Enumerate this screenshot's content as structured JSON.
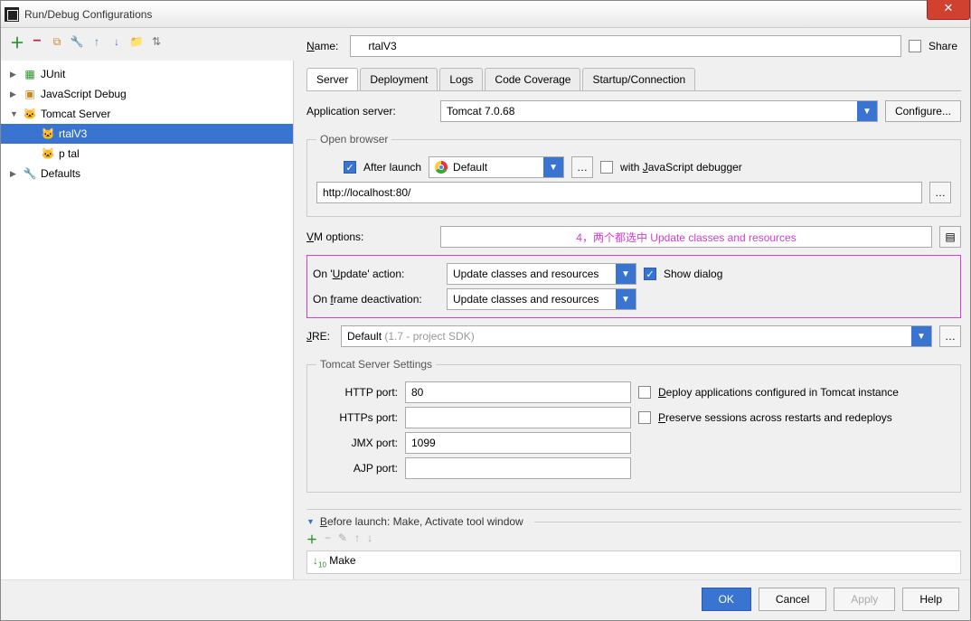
{
  "title": "Run/Debug Configurations",
  "share_label": "Share",
  "toolbar_icons": [
    "add",
    "remove",
    "copy",
    "wrench",
    "up",
    "down",
    "folder",
    "sort"
  ],
  "tree": {
    "items": [
      {
        "label": "JUnit",
        "expandable": true,
        "expanded": false
      },
      {
        "label": "JavaScript Debug",
        "expandable": true,
        "expanded": false
      },
      {
        "label": "Tomcat Server",
        "expandable": true,
        "expanded": true,
        "children": [
          {
            "label": "    rtalV3",
            "selected": true
          },
          {
            "label": "p    tal"
          }
        ]
      },
      {
        "label": "Defaults",
        "expandable": true,
        "expanded": false
      }
    ]
  },
  "name_label": "Name:",
  "name_value": "    rtalV3",
  "tabs": [
    "Server",
    "Deployment",
    "Logs",
    "Code Coverage",
    "Startup/Connection"
  ],
  "active_tab": 0,
  "app_server_label": "Application server:",
  "app_server_value": "Tomcat 7.0.68",
  "configure_label": "Configure...",
  "open_browser": {
    "legend": "Open browser",
    "after_launch": "After launch",
    "browser_value": "Default",
    "with_js": "with JavaScript debugger",
    "url": "http://localhost:80/"
  },
  "vm_options_label": "VM options:",
  "annotation": "4，两个都选中 Update classes and resources",
  "on_update_label": "On 'Update' action:",
  "on_update_value": "Update classes and resources",
  "show_dialog": "Show dialog",
  "on_frame_label": "On frame deactivation:",
  "on_frame_value": "Update classes and resources",
  "jre_label": "JRE:",
  "jre_value_prefix": "Default ",
  "jre_value_muted": "(1.7 - project SDK)",
  "tomcat_settings": {
    "legend": "Tomcat Server Settings",
    "http_port": "HTTP port:",
    "http_port_val": "80",
    "https_port": "HTTPs port:",
    "https_port_val": "",
    "jmx_port": "JMX port:",
    "jmx_port_val": "1099",
    "ajp_port": "AJP port:",
    "ajp_port_val": "",
    "deploy_chk": "Deploy applications configured in Tomcat instance",
    "preserve_chk": "Preserve sessions across restarts and redeploys"
  },
  "before_launch": {
    "title": "Before launch: Make, Activate tool window",
    "item": "Make"
  },
  "buttons": {
    "ok": "OK",
    "cancel": "Cancel",
    "apply": "Apply",
    "help": "Help"
  }
}
